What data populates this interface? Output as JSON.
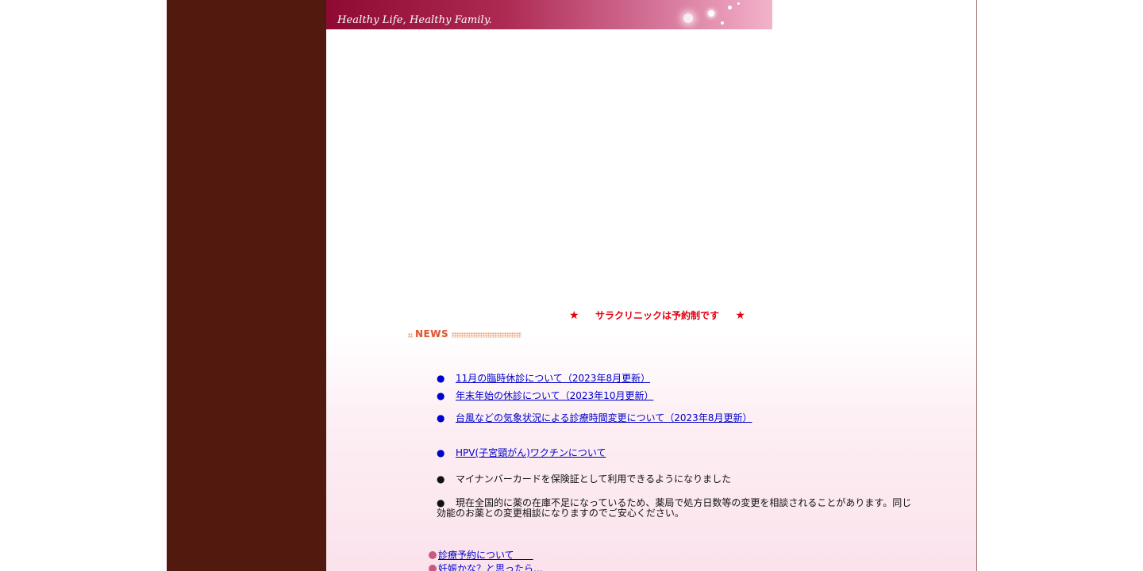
{
  "banner": {
    "tagline": "Healthy Life, Healthy Family."
  },
  "notice": {
    "star_left": "★",
    "text": "サラクリニックは予約制です",
    "star_right": "★"
  },
  "news": {
    "heading": "NEWS",
    "items": [
      {
        "bullet": "●",
        "text": "11月の臨時休診について（2023年8月更新）",
        "link": true
      },
      {
        "bullet": "●",
        "text": "年末年始の休診について（2023年10月更新）",
        "link": true
      },
      {
        "bullet": "●",
        "text": "台風などの気象状況による診療時間変更について（2023年8月更新）",
        "link": true
      },
      {
        "bullet": "●",
        "text": "HPV(子宮頸がん)ワクチンについて",
        "link": true
      },
      {
        "bullet": "●",
        "text": "マイナンバーカードを保険証として利用できるようになりました",
        "link": false
      },
      {
        "bullet": "●",
        "text": "現在全国的に薬の在庫不足になっているため、薬局で処方日数等の変更を相談されることがあります。同じ効能のお薬との変更相談になりますのでご安心ください。",
        "link": false
      }
    ]
  },
  "menu": {
    "items": [
      {
        "text": "診療予約について　　"
      },
      {
        "text": "妊娠かな？と思ったら…"
      }
    ]
  },
  "colors": {
    "sidebar": "#521a0e",
    "banner_start": "#8e0a33",
    "banner_end": "#f3b2cb",
    "notice": "#e0000f",
    "link": "#0000cc",
    "menu_bullet": "#c85a82"
  }
}
